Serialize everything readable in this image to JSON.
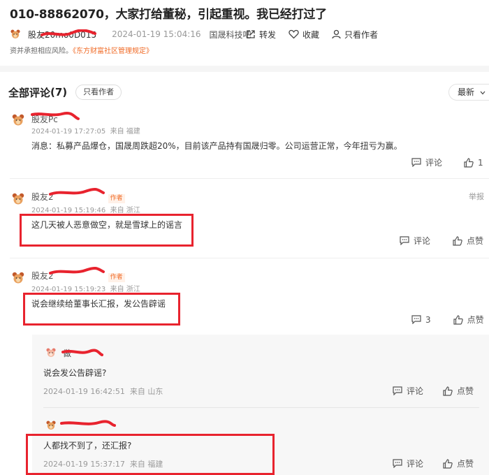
{
  "post": {
    "title": "010-88862070，大家打给董秘，引起重视。我已经打过了",
    "author": "股友2",
    "author_hidden_tail": "0mo0D015",
    "time": "2024-01-19 15:04:16",
    "source": "国晟科技吧",
    "actions": {
      "forward": "转发",
      "favorite": "收藏",
      "author_only": "只看作者"
    },
    "disclaimer_prefix": "资并承担相应风险。",
    "disclaimer_link": "《东方财富社区管理规定》"
  },
  "comments_section": {
    "title": "全部评论",
    "count": "(7)",
    "author_only_chip": "只看作者",
    "sort_label": "最新"
  },
  "comments": [
    {
      "user": "股友Pc",
      "author_badge": "",
      "time": "2024-01-19 17:27:05",
      "location": "来自 福建",
      "text": "消息：私募产品爆仓，国晟周跌超20%，目前该产品持有国晟归零。公司运营正常，今年扭亏为赢。",
      "comment_label": "评论",
      "like_label": "1",
      "report_label": ""
    },
    {
      "user": "股友2",
      "author_badge": "作者",
      "time": "2024-01-19 15:19:46",
      "location": "来自 浙江",
      "text": "这几天被人恶意做空，就是雪球上的谣言",
      "comment_label": "评论",
      "like_label": "点赞",
      "report_label": "举报"
    },
    {
      "user": "股友2",
      "author_badge": "作者",
      "time": "2024-01-19 15:19:23",
      "location": "来自 浙江",
      "text": "说会继续给董事长汇报，发公告辟谣",
      "comment_label": "3",
      "like_label": "点赞",
      "report_label": ""
    }
  ],
  "replies": [
    {
      "user": "做",
      "text": "说会发公告辟谣?",
      "time": "2024-01-19 16:42:51",
      "location": "来自 山东",
      "comment_label": "评论",
      "like_label": "点赞"
    },
    {
      "user": "",
      "text": "人都找不到了，还汇报?",
      "time": "2024-01-19 15:37:17",
      "location": "来自 福建",
      "comment_label": "评论",
      "like_label": "点赞"
    }
  ],
  "colors": {
    "accent": "#f06b27",
    "annotation_red": "#e8232e",
    "muted": "#999999"
  },
  "icons": [
    "user-avatar-icon",
    "share-icon",
    "heart-icon",
    "person-icon",
    "comment-icon",
    "thumbs-up-icon",
    "chevron-down-icon"
  ]
}
